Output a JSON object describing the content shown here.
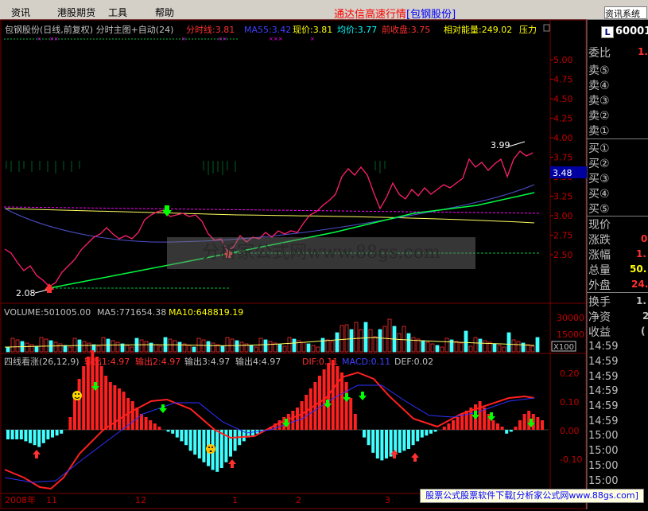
{
  "menu": {
    "items": [
      "资讯",
      "港股期货",
      "工具",
      "帮助"
    ]
  },
  "app": {
    "title_prefix": "通达信高速行情",
    "title_stock": "[包钢股份]",
    "search_label": "资讯系统"
  },
  "main_chart": {
    "header": "包钢股份(日线,前复权) 分时主图+自动(24)",
    "fenshi": "分时线:3.81",
    "ma55": "MA55:3.42",
    "xianjia": "现价:3.81",
    "junjia": "均价:3.77",
    "qianshou": "前收盘:3.75",
    "nengliang": "相对能量:249.02",
    "yali": "压力",
    "price_axis": [
      "5.00",
      "4.75",
      "4.50",
      "4.25",
      "4.00",
      "3.75",
      "3.50",
      "3.25",
      "3.00",
      "2.75",
      "2.50"
    ],
    "current_price": "3.48",
    "high_label": "3.99",
    "low_label": "2.08",
    "colors": {
      "price": "#ff1f6e",
      "ma55": "#5050d0",
      "trend_green": "#00ff40",
      "trend_yellow": "#ffff60",
      "magenta_dash": "#ff00ff"
    }
  },
  "volume": {
    "header": "VOLUME:501005.00",
    "ma5": "MA5:771654.38",
    "ma10": "MA10:648819.19",
    "axis": [
      "30000",
      "15000"
    ],
    "unit": "X100"
  },
  "macd": {
    "header": "四线看涨(26,12,9)",
    "out1": "输出1:4.97",
    "out2": "输出2:4.97",
    "out3": "输出3:4.97",
    "out4": "输出4:4.97",
    "dif": "DIF:0.11",
    "macdv": "MACD:0.11",
    "def": "DEF:0.02",
    "axis": [
      "0.20",
      "0.10",
      "0.00",
      "-0.10"
    ]
  },
  "date_axis": {
    "labels": [
      "2008年",
      "11",
      "12",
      "1",
      "2",
      "3"
    ]
  },
  "sidebar": {
    "code": "60001",
    "weibi": "委比",
    "weibi_val": "1.",
    "sell": [
      "卖⑤",
      "卖④",
      "卖③",
      "卖②",
      "卖①"
    ],
    "buy": [
      "买①",
      "买②",
      "买③",
      "买④",
      "买⑤"
    ],
    "stats": [
      {
        "label": "现价",
        "val": ""
      },
      {
        "label": "涨跌",
        "val": "0"
      },
      {
        "label": "涨幅",
        "val": "1."
      },
      {
        "label": "总量",
        "val": "50."
      },
      {
        "label": "外盘",
        "val": "24."
      }
    ],
    "stats2": [
      {
        "label": "换手",
        "val": "1."
      },
      {
        "label": "净资",
        "val": "2"
      },
      {
        "label": "收益",
        "val": "("
      }
    ],
    "times": [
      "14:59",
      "14:59",
      "14:59",
      "14:59",
      "14:59",
      "14:59",
      "15:00",
      "15:00",
      "15:00",
      "15:00",
      "15:00",
      "15:00"
    ]
  },
  "footer": {
    "text": "股票公式股票软件下载[分析家公式网www.88gs.com]"
  },
  "watermark": "分析家公式网www.88gs.com"
}
